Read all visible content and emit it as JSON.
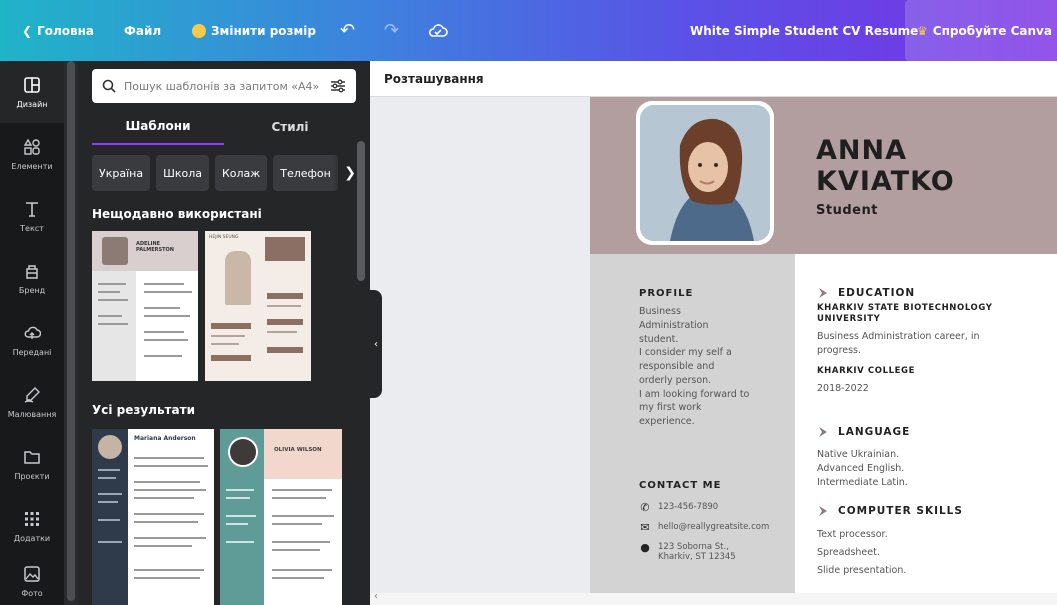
{
  "topbar": {
    "home": "Головна",
    "file": "Файл",
    "resize": "Змінити розмір",
    "doc_title": "White Simple Student CV Resume",
    "try_pro": "Спробуйте Canva Pro"
  },
  "rail": {
    "items": [
      {
        "label": "Дизайн",
        "icon": "layout-icon"
      },
      {
        "label": "Елементи",
        "icon": "shapes-icon"
      },
      {
        "label": "Текст",
        "icon": "text-icon"
      },
      {
        "label": "Бренд",
        "icon": "brand-icon"
      },
      {
        "label": "Передані",
        "icon": "upload-icon"
      },
      {
        "label": "Малювання",
        "icon": "draw-icon"
      },
      {
        "label": "Проєкти",
        "icon": "folder-icon"
      },
      {
        "label": "Додатки",
        "icon": "apps-icon"
      },
      {
        "label": "Фото",
        "icon": "photo-icon"
      }
    ]
  },
  "panel": {
    "search_placeholder": "Пошук шаблонів за запитом «А4»",
    "tabs": [
      "Шаблони",
      "Стилі"
    ],
    "chips": [
      "Україна",
      "Школа",
      "Колаж",
      "Телефон"
    ],
    "recent_title": "Нещодавно використані",
    "results_title": "Усі результати",
    "recent": [
      {
        "name": "ADELINE PALMERSTON"
      },
      {
        "name": "HEJIN SEUNG"
      }
    ],
    "results": [
      {
        "name": "Mariana Anderson"
      },
      {
        "name": "OLIVIA WILSON"
      }
    ]
  },
  "workarea": {
    "toolbar_label": "Розташування"
  },
  "resume": {
    "first_name": "ANNA",
    "last_name": "KVIATKO",
    "role": "Student",
    "profile_heading": "PROFILE",
    "profile_lines": [
      "Business",
      "Administration",
      "student.",
      "I consider my self a",
      "responsible and",
      "orderly person.",
      "I am looking forward to",
      "my first work",
      "experience."
    ],
    "contact_heading": "CONTACT ME",
    "phone": "123-456-7890",
    "email": "hello@reallygreatsite.com",
    "address_lines": [
      "123 Soborna St.,",
      "Kharkiv, ST 12345"
    ],
    "education_heading": "EDUCATION",
    "uni1_lines": [
      "KHARKIV STATE BIOTECHNOLOGY",
      "UNIVERSITY"
    ],
    "uni1_desc_lines": [
      "Business Administration career, in",
      "progress."
    ],
    "uni2": "KHARKIV COLLEGE",
    "uni2_years": "2018-2022",
    "language_heading": "LANGUAGE",
    "languages": [
      "Native Ukrainian.",
      "Advanced English.",
      "Intermediate Latin."
    ],
    "skills_heading": "COMPUTER SKILLS",
    "skills": [
      "Text processor.",
      "Spreadsheet.",
      "Slide presentation."
    ]
  },
  "colors": {
    "header_band": "#b39e9f",
    "left_column": "#d3d3d3",
    "accent_purple": "#8b3dff"
  }
}
